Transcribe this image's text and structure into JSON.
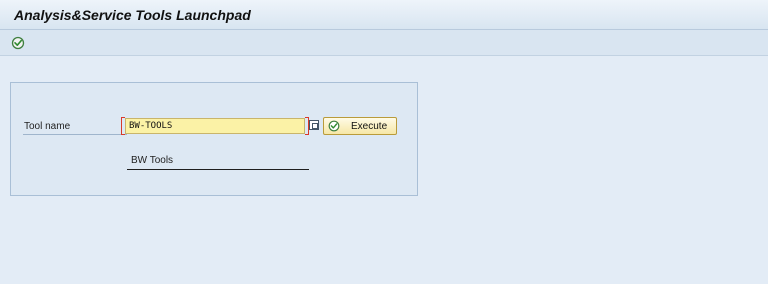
{
  "window": {
    "title": "Analysis&Service Tools Launchpad"
  },
  "toolbar": {
    "execute_icon": "execute-icon"
  },
  "form": {
    "tool_name_label": "Tool name",
    "tool_name_value": "BW-TOOLS",
    "tool_description": "BW Tools",
    "execute_label": "Execute",
    "value_help_icon": "value-help-icon"
  },
  "colors": {
    "background": "#e3ecf6",
    "input_background": "#fbf2a6",
    "button_background": "#f6e7a6",
    "required_marker": "#d83a2a"
  }
}
